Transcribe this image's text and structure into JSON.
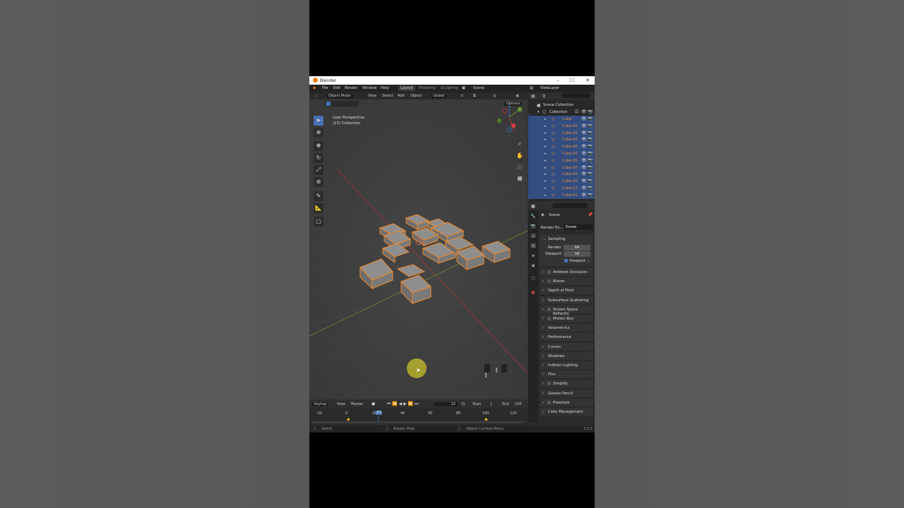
{
  "window": {
    "title": "Blender"
  },
  "menu": {
    "file": "File",
    "edit": "Edit",
    "render": "Render",
    "window": "Window",
    "help": "Help",
    "tabs": [
      "Layout",
      "Modeling",
      "Sculpting"
    ],
    "scene": "Scene",
    "view_layer": "ViewLayer"
  },
  "viewport_header": {
    "mode": "Object Mode",
    "view": "View",
    "select": "Select",
    "add": "Add",
    "object": "Object",
    "orientation": "Global",
    "options": "Options"
  },
  "viewport": {
    "perspective": "User Perspective",
    "collection": "(23) Collection"
  },
  "timeline": {
    "keying": "Keying",
    "view": "View",
    "marker": "Marker",
    "current_frame": "23",
    "start_label": "Start",
    "start": "1",
    "end_label": "End",
    "end": "100",
    "ticks": [
      "-20",
      "0",
      "20",
      "40",
      "60",
      "80",
      "100",
      "120"
    ],
    "playhead": "23"
  },
  "status": {
    "select": "Select",
    "rotate": "Rotate View",
    "context": "Object Context Menu",
    "version": "3.3.1"
  },
  "outliner": {
    "scene_collection": "Scene Collection",
    "collection": "Collection",
    "items": [
      "Cube",
      "Cube.00",
      "Cube.00",
      "Cube.00",
      "Cube.00",
      "Cube.00",
      "Cube.00",
      "Cube.00",
      "Cube.00",
      "Cube.00",
      "Cube.01",
      "Cube.01"
    ]
  },
  "properties": {
    "scene": "Scene",
    "render_engine_label": "Render En...",
    "render_engine": "Eevee",
    "sampling": "Sampling",
    "render_label": "Render",
    "render_samples": "64",
    "viewport_label": "Viewport",
    "viewport_samples": "16",
    "viewport_denoise": "Viewport ...",
    "panels": [
      {
        "label": "Ambient Occlusion",
        "checkbox": true
      },
      {
        "label": "Bloom",
        "checkbox": true
      },
      {
        "label": "Depth of Field",
        "checkbox": false
      },
      {
        "label": "Subsurface Scattering",
        "checkbox": false
      },
      {
        "label": "Screen Space Reflectio",
        "checkbox": true
      },
      {
        "label": "Motion Blur",
        "checkbox": true
      },
      {
        "label": "Volumetrics",
        "checkbox": false
      },
      {
        "label": "Performance",
        "checkbox": false
      },
      {
        "label": "Curves",
        "checkbox": false
      },
      {
        "label": "Shadows",
        "checkbox": false
      },
      {
        "label": "Indirect Lighting",
        "checkbox": false
      },
      {
        "label": "Film",
        "checkbox": false
      },
      {
        "label": "Simplify",
        "checkbox": true
      },
      {
        "label": "Grease Pencil",
        "checkbox": false
      },
      {
        "label": "Freestyle",
        "checkbox": true
      },
      {
        "label": "Color Management",
        "checkbox": false
      }
    ]
  }
}
